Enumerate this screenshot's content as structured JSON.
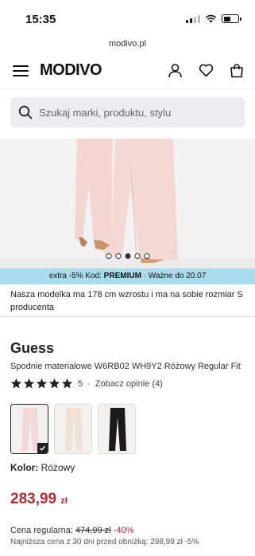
{
  "status": {
    "time": "15:35"
  },
  "browser": {
    "url": "modivo.pl"
  },
  "header": {
    "logo": "MODIVO"
  },
  "search": {
    "placeholder": "Szukaj marki, produktu, stylu"
  },
  "gallery": {
    "total_images": 5,
    "active_index": 2
  },
  "promo": {
    "prefix": "extra -5% Kod: ",
    "code": "PREMIUM",
    "suffix": " · Ważne do 20.07"
  },
  "model_info": "Nasza modelka ma 178 cm wzrostu i ma na sobie rozmiar S producenta",
  "product": {
    "brand": "Guess",
    "name": "Spodnie materiałowe W6RB02 WH9Y2 Różowy Regular Fit",
    "rating_value": 5,
    "rating_label": "5",
    "reviews_link": "Zobacz opinie (4)",
    "color_label": "Kolor:",
    "color_value": "Różowy",
    "price": "283,99",
    "currency": "zł",
    "regular_label": "Cena regularna:",
    "regular_price": "474,99 zł",
    "discount": "-40%",
    "cut_text": "Najniższa cena z 30 dni przed obniżką: 298,99 zł -5%"
  },
  "colors": [
    {
      "name": "Różowy",
      "selected": true,
      "hex": "#f2d9d6"
    },
    {
      "name": "Beżowy",
      "selected": false,
      "hex": "#efe2d3"
    },
    {
      "name": "Czarny",
      "selected": false,
      "hex": "#1a1a1a"
    }
  ],
  "theme": {
    "accent": "#b12a3a",
    "promo_bg": "#a8dcec"
  }
}
